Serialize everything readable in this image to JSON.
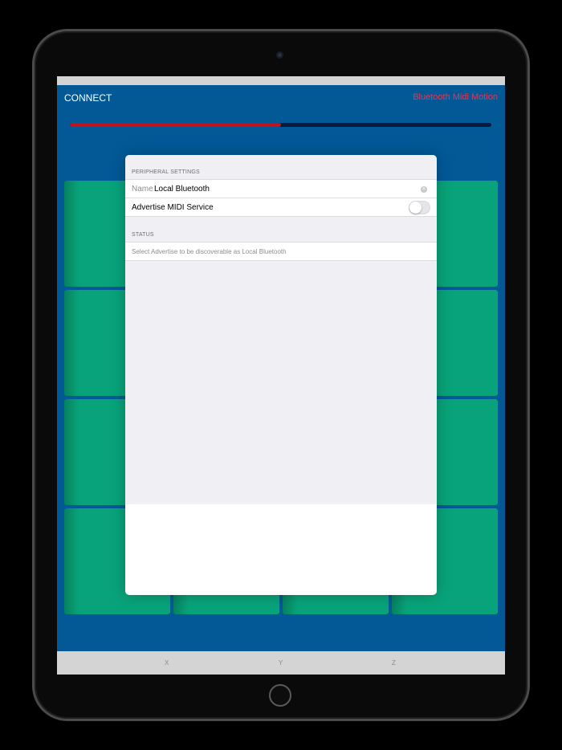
{
  "screen": {
    "connect_label": "CONNECT",
    "app_title": "Bluetooth Midi Motion",
    "progress_percent": 50,
    "pad_count": 16,
    "axis_labels": [
      "X",
      "Y",
      "Z"
    ]
  },
  "modal": {
    "peripheral_header": "PERIPHERAL SETTINGS",
    "name_label": "Name",
    "name_value": "Local Bluetooth",
    "advertise_label": "Advertise MIDI Service",
    "advertise_on": false,
    "status_header": "STATUS",
    "status_text": "Select Advertise to be discoverable as Local Bluetooth"
  },
  "icons": {
    "clear": "clear-icon",
    "camera": "camera-icon",
    "home": "home-button-icon"
  },
  "colors": {
    "screen_bg": "#025996",
    "pad_green": "#08a37a",
    "title_accent": "#d83c5c",
    "progress_fill": "#c0131f",
    "progress_track": "#071a3a"
  }
}
